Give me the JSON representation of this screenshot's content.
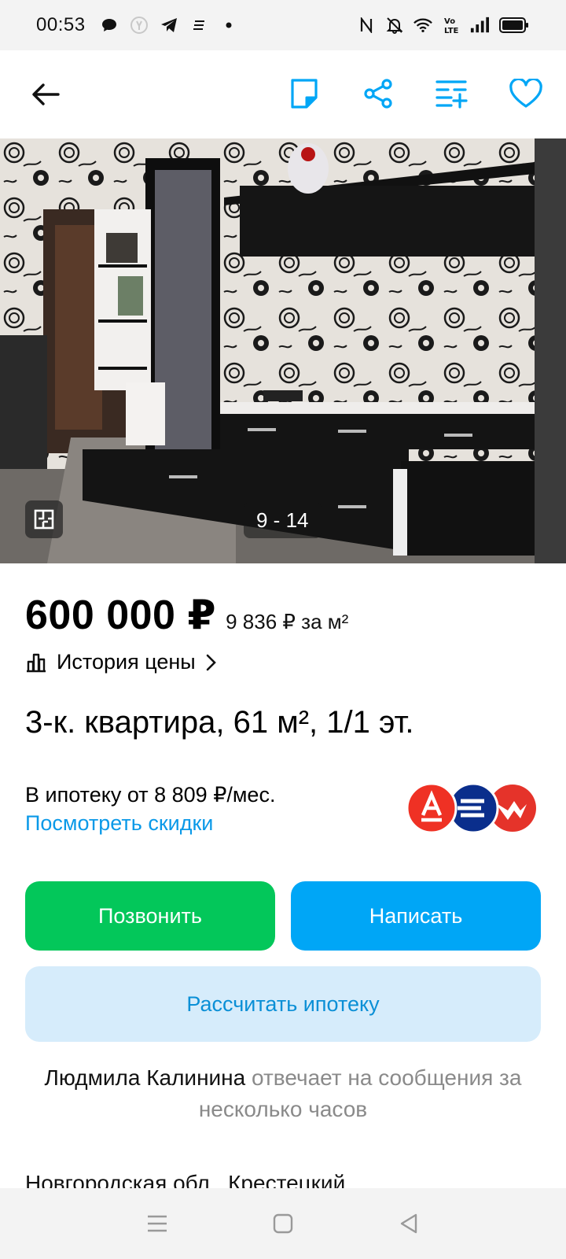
{
  "status_bar": {
    "time": "00:53",
    "left_icons": [
      "chat-bubble-icon",
      "yandex-icon",
      "telegram-icon",
      "notes-icon",
      "dot-icon"
    ],
    "right_icons": [
      "nfc-icon",
      "mute-bell-icon",
      "wifi-icon",
      "volte-icon",
      "signal-icon",
      "battery-icon"
    ]
  },
  "app_bar": {
    "icons": [
      "back-arrow-icon",
      "note-icon",
      "share-icon",
      "compare-list-icon",
      "heart-icon"
    ],
    "accent": "#00a6f6"
  },
  "photo": {
    "counter": "9 - 14",
    "plan_icon": "floor-plan-icon"
  },
  "listing": {
    "price": "600 000 ₽",
    "price_per_sqm": "9 836 ₽ за м²",
    "price_history_label": "История цены",
    "title": "3-к. квартира, 61 м², 1/1 эт.",
    "mortgage_text": "В ипотеку от 8 809 ₽/мес.",
    "mortgage_link": "Посмотреть скидки",
    "bank_logos": [
      "alfa-bank-logo",
      "bank-stripes-logo",
      "bank-wings-logo"
    ]
  },
  "actions": {
    "call": "Позвонить",
    "write": "Написать",
    "calculate_mortgage": "Рассчитать ипотеку"
  },
  "seller": {
    "name": "Людмила Калинина",
    "response_text": " отвечает на сообщения за несколько часов"
  },
  "address_partial": "Новгородская обл., Крестецкий",
  "colors": {
    "call_green": "#03c75a",
    "write_blue": "#00a6f6",
    "calc_bg": "#d6ecfb",
    "link_blue": "#0a99e8"
  },
  "nav_bar": {
    "icons": [
      "menu-icon",
      "home-square-icon",
      "back-triangle-icon"
    ]
  }
}
